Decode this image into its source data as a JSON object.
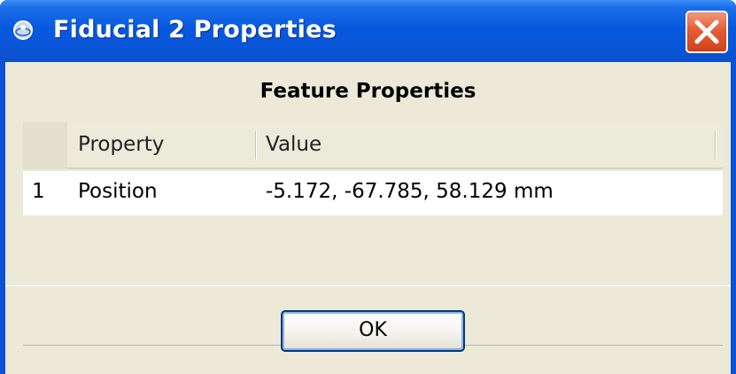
{
  "window": {
    "title": "Fiducial 2 Properties",
    "icon": "app-orb-icon",
    "close_icon": "close-icon"
  },
  "panel": {
    "title": "Feature Properties"
  },
  "table": {
    "columns": [
      "Property",
      "Value"
    ],
    "rows": [
      {
        "index": "1",
        "property": "Position",
        "value": "-5.172, -67.785, 58.129 mm"
      }
    ]
  },
  "buttons": {
    "ok_label": "OK"
  },
  "colors": {
    "titlebar": "#0858df",
    "close_button": "#e45d34",
    "client_background": "#ece9d8"
  }
}
